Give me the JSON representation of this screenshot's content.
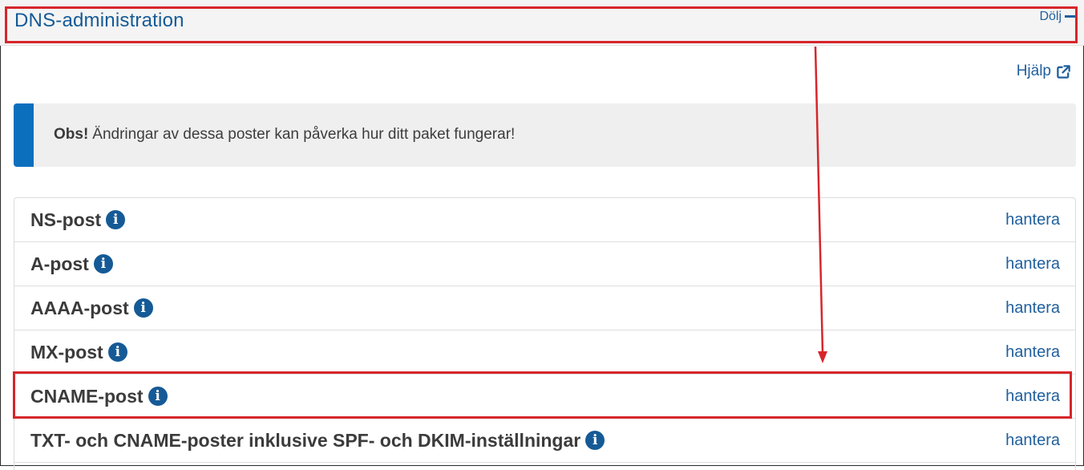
{
  "header": {
    "title": "DNS-administration",
    "toggle_label": "Dölj",
    "toggle_icon": "minus-icon"
  },
  "help": {
    "label": "Hjälp",
    "icon": "external-link-icon"
  },
  "notice": {
    "strong": "Obs!",
    "text": "Ändringar av dessa poster kan påverka hur ditt paket fungerar!",
    "accent_color": "#0b6fbe"
  },
  "records": [
    {
      "label": "NS-post",
      "action": "hantera"
    },
    {
      "label": "A-post",
      "action": "hantera"
    },
    {
      "label": "AAAA-post",
      "action": "hantera"
    },
    {
      "label": "MX-post",
      "action": "hantera"
    },
    {
      "label": "CNAME-post",
      "action": "hantera"
    },
    {
      "label": "TXT- och CNAME-poster inklusive SPF- och DKIM-inställningar",
      "action": "hantera"
    }
  ],
  "colors": {
    "link": "#1f5f9d",
    "title": "#155a96",
    "annotation": "#d6262b"
  },
  "annotations": {
    "highlighted_record": "CNAME-post"
  }
}
